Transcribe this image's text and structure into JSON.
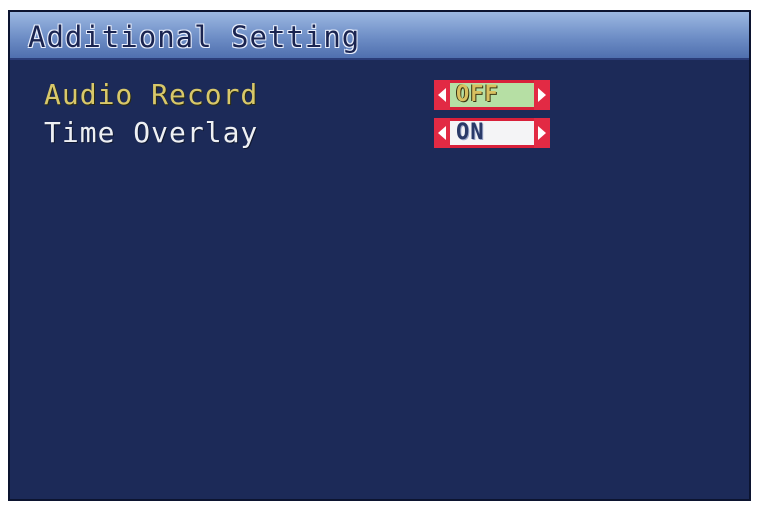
{
  "window": {
    "title": "Additional Setting"
  },
  "menu": {
    "items": [
      {
        "label": "Audio Record",
        "value": "OFF",
        "selected": true
      },
      {
        "label": "Time Overlay",
        "value": "ON",
        "selected": false
      }
    ]
  },
  "icons": {
    "left": "arrow-left-icon",
    "right": "arrow-right-icon"
  },
  "colors": {
    "background": "#1c2a58",
    "title_bar": "#6e8ec6",
    "selected_label": "#d8c86a",
    "normal_label": "#eef0f4",
    "selector_red": "#d8203a"
  }
}
